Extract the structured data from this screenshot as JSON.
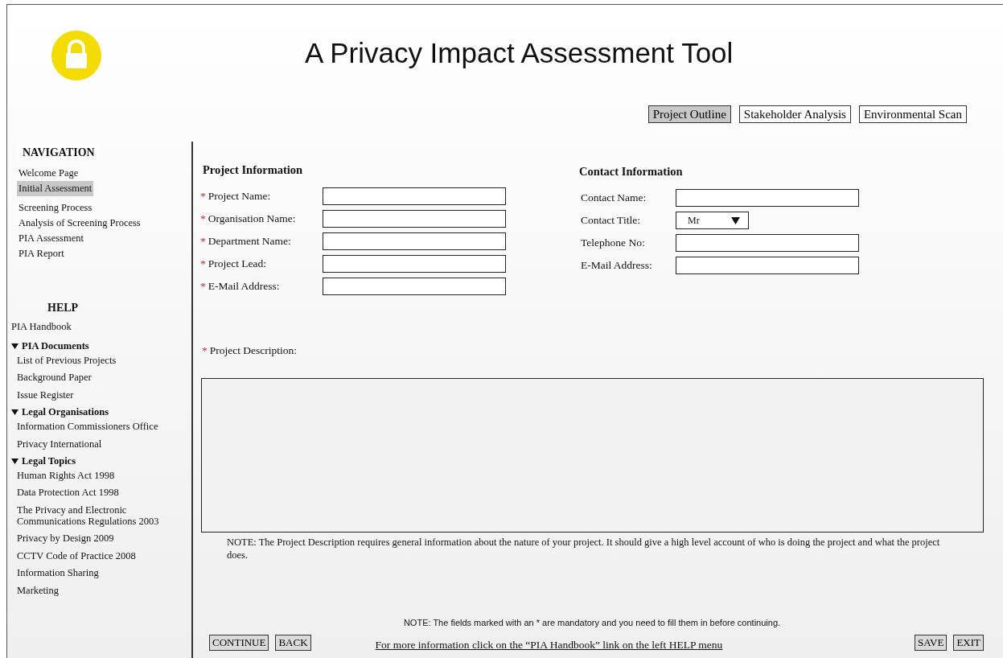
{
  "header": {
    "title": "A Privacy Impact Assessment Tool"
  },
  "tabs": [
    {
      "label": "Project Outline",
      "selected": true
    },
    {
      "label": "Stakeholder Analysis",
      "selected": false
    },
    {
      "label": "Environmental Scan",
      "selected": false
    }
  ],
  "navigation": {
    "heading": "NAVIGATION",
    "items": [
      {
        "label": "Welcome Page",
        "selected": false
      },
      {
        "label": "Initial Assessment",
        "selected": true
      },
      {
        "label": "Screening Process",
        "selected": false
      },
      {
        "label": "Analysis of Screening Process",
        "selected": false
      },
      {
        "label": "PIA Assessment",
        "selected": false
      },
      {
        "label": "PIA Report",
        "selected": false
      }
    ]
  },
  "help": {
    "heading": "HELP",
    "items": [
      {
        "kind": "link",
        "label": "PIA Handbook"
      },
      {
        "kind": "group",
        "label": "PIA Documents",
        "expanded": true,
        "children": [
          "List of Previous Projects",
          "Background Paper",
          "Issue Register"
        ]
      },
      {
        "kind": "group",
        "label": "Legal Organisations",
        "expanded": true,
        "children": [
          "Information Commissioners Office",
          "Privacy International"
        ]
      },
      {
        "kind": "group",
        "label": "Legal Topics",
        "expanded": true,
        "children": [
          "Human Rights Act 1998",
          "Data Protection Act 1998",
          "The Privacy and Electronic Communications Regulations 2003",
          "Privacy by Design 2009",
          "CCTV Code of Practice 2008",
          "Information Sharing",
          "Marketing"
        ]
      }
    ]
  },
  "project_information": {
    "heading": "Project Information",
    "fields": [
      {
        "label": "Project Name:",
        "required_mark": "*"
      },
      {
        "label": "Organisation Name:",
        "required_mark": "*"
      },
      {
        "label": "Department Name:",
        "required_mark": "*"
      },
      {
        "label": "Project Lead:",
        "required_mark": "*"
      },
      {
        "label": "E-Mail Address:",
        "required_mark": "*"
      }
    ]
  },
  "contact_information": {
    "heading": "Contact Information",
    "fields": [
      {
        "kind": "text",
        "label": "Contact Name:"
      },
      {
        "kind": "select",
        "label": "Contact Title:",
        "value": "Mr"
      },
      {
        "kind": "text",
        "label": "Telephone No:"
      },
      {
        "kind": "text",
        "label": "E-Mail Address:"
      }
    ]
  },
  "description": {
    "required_mark": "*",
    "label": "Project Description:",
    "note": "NOTE: The Project Description requires general information about the nature of your project. It should give a high level account of who is doing the project and what the project does."
  },
  "footer": {
    "note": "NOTE: The fields marked with an * are mandatory and you need to fill them in before continuing.",
    "left_buttons": [
      "CONTINUE",
      "BACK"
    ],
    "link": "For more information click on the “PIA Handbook” link on the left HELP menu",
    "right_buttons": [
      "SAVE",
      "EXIT"
    ]
  }
}
